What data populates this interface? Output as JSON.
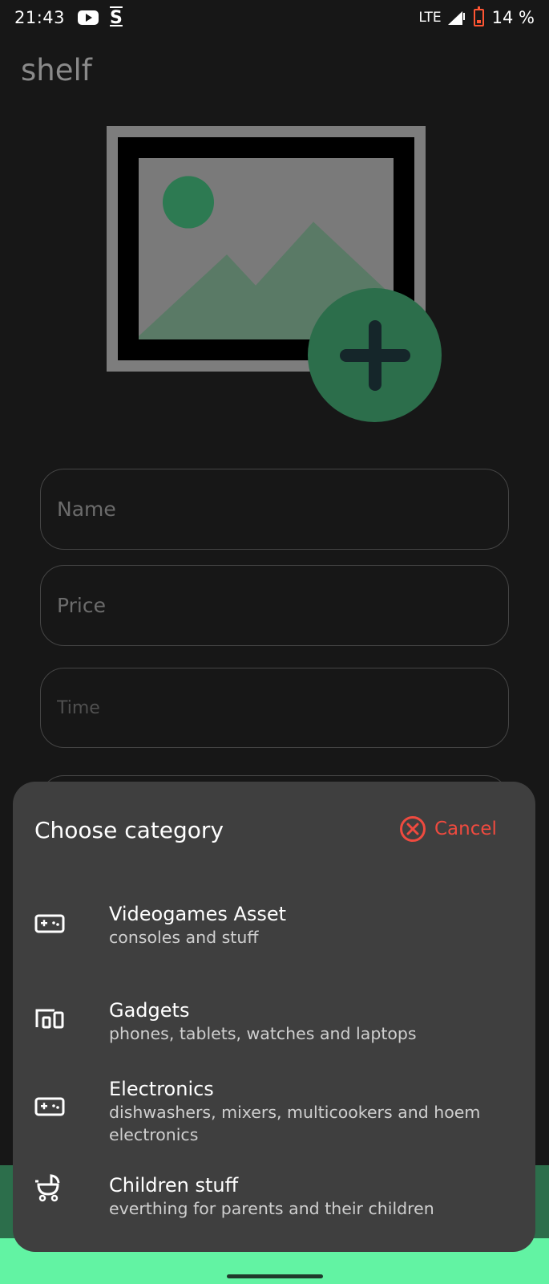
{
  "status_bar": {
    "time": "21:43",
    "network": "LTE",
    "battery": "14 %",
    "icons": [
      "youtube-icon",
      "s-app-icon",
      "signal-icon",
      "battery-low-icon"
    ]
  },
  "app": {
    "title": "shelf"
  },
  "image_picker": {
    "icon": "image-placeholder-icon",
    "add_icon": "plus-icon"
  },
  "form": {
    "name_placeholder": "Name",
    "price_placeholder": "Price",
    "time_placeholder": "Time"
  },
  "sheet": {
    "title": "Choose category",
    "cancel_label": "Cancel",
    "categories": [
      {
        "title": "Videogames Asset",
        "description": "consoles and stuff",
        "icon": "gamepad-icon"
      },
      {
        "title": "Gadgets",
        "description": "phones, tablets, watches and laptops",
        "icon": "devices-icon"
      },
      {
        "title": "Electronics",
        "description": "dishwashers, mixers, multicookers and hoem electronics",
        "icon": "gamepad-icon"
      },
      {
        "title": "Children stuff",
        "description": "everthing for parents and their children",
        "icon": "stroller-icon"
      }
    ]
  },
  "colors": {
    "background": "#171717",
    "sheet": "#3f3f3f",
    "accent_green": "#2c6e4b",
    "nav_green": "#62f3a3",
    "cancel_red": "#ef4a3f"
  }
}
